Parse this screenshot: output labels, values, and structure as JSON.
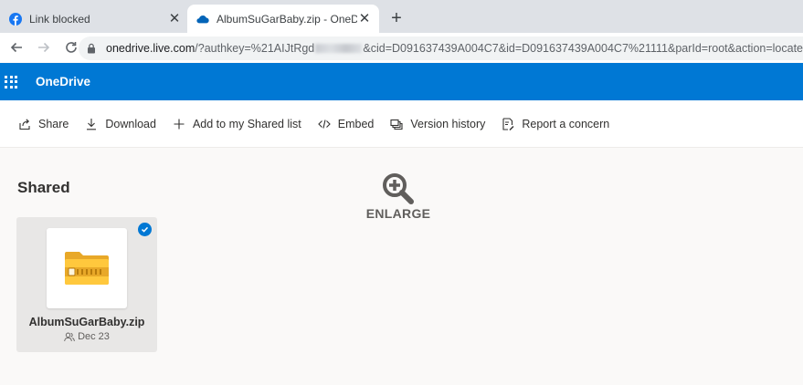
{
  "browser": {
    "tabs": [
      {
        "title": "Link blocked",
        "favicon": "facebook-icon",
        "active": false
      },
      {
        "title": "AlbumSuGarBaby.zip - OneDrive",
        "favicon": "onedrive-icon",
        "active": true
      }
    ],
    "new_tab_label": "+",
    "url": {
      "host": "onedrive.live.com",
      "path_start": "/?authkey=%21AIJtRgd",
      "path_end": "&cid=D091637439A004C7&id=D091637439A004C7%21111&parId=root&action=locate"
    }
  },
  "app": {
    "name": "OneDrive",
    "accent": "#0078d4"
  },
  "commands": [
    {
      "label": "Share",
      "icon": "share-icon"
    },
    {
      "label": "Download",
      "icon": "download-icon"
    },
    {
      "label": "Add to my Shared list",
      "icon": "plus-icon"
    },
    {
      "label": "Embed",
      "icon": "code-icon"
    },
    {
      "label": "Version history",
      "icon": "version-history-icon"
    },
    {
      "label": "Report a concern",
      "icon": "report-icon"
    }
  ],
  "main": {
    "section_title": "Shared",
    "overlay_label": "ENLARGE",
    "file": {
      "name": "AlbumSuGarBaby.zip",
      "date": "Dec 23",
      "icon": "zip-folder-icon",
      "selected": true
    }
  }
}
